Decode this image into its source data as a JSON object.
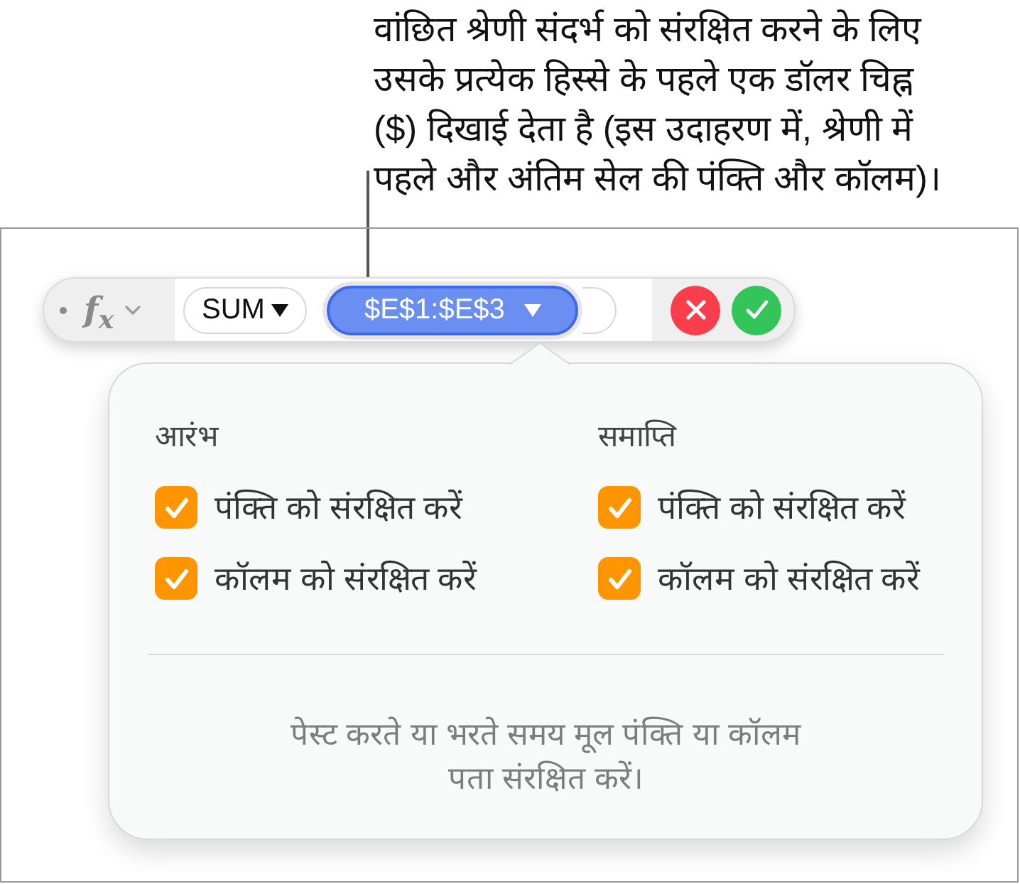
{
  "callout": {
    "lines": [
      "वांछित श्रेणी संदर्भ को संरक्षित करने के लिए",
      "उसके प्रत्येक हिस्से के पहले एक डॉलर चिह्न",
      "($) दिखाई देता है (इस उदाहरण में, श्रेणी में",
      "पहले और अंतिम सेल की पंक्ति और कॉलम)।"
    ]
  },
  "formula_bar": {
    "function_button": "f$_{x}$",
    "tokens": [
      {
        "kind": "token",
        "label": "SUM",
        "selected": false
      },
      {
        "kind": "token",
        "label": "$E$1:$E$3",
        "selected": true
      },
      {
        "kind": "empty",
        "selected": false
      }
    ]
  },
  "popover": {
    "sections": [
      {
        "heading": "आरंभ",
        "options": [
          {
            "label": "पंक्ति को संरक्षित करें",
            "checked": true
          },
          {
            "label": "कॉलम को संरक्षित करें",
            "checked": true
          }
        ]
      },
      {
        "heading": "समाप्ति",
        "options": [
          {
            "label": "पंक्ति को संरक्षित करें",
            "checked": true
          },
          {
            "label": "कॉलम को संरक्षित करें",
            "checked": true
          }
        ]
      }
    ],
    "note_lines": [
      "पेस्ट करते या भरते समय मूल पंक्ति या कॉलम",
      "पता संरक्षित करें।"
    ]
  }
}
